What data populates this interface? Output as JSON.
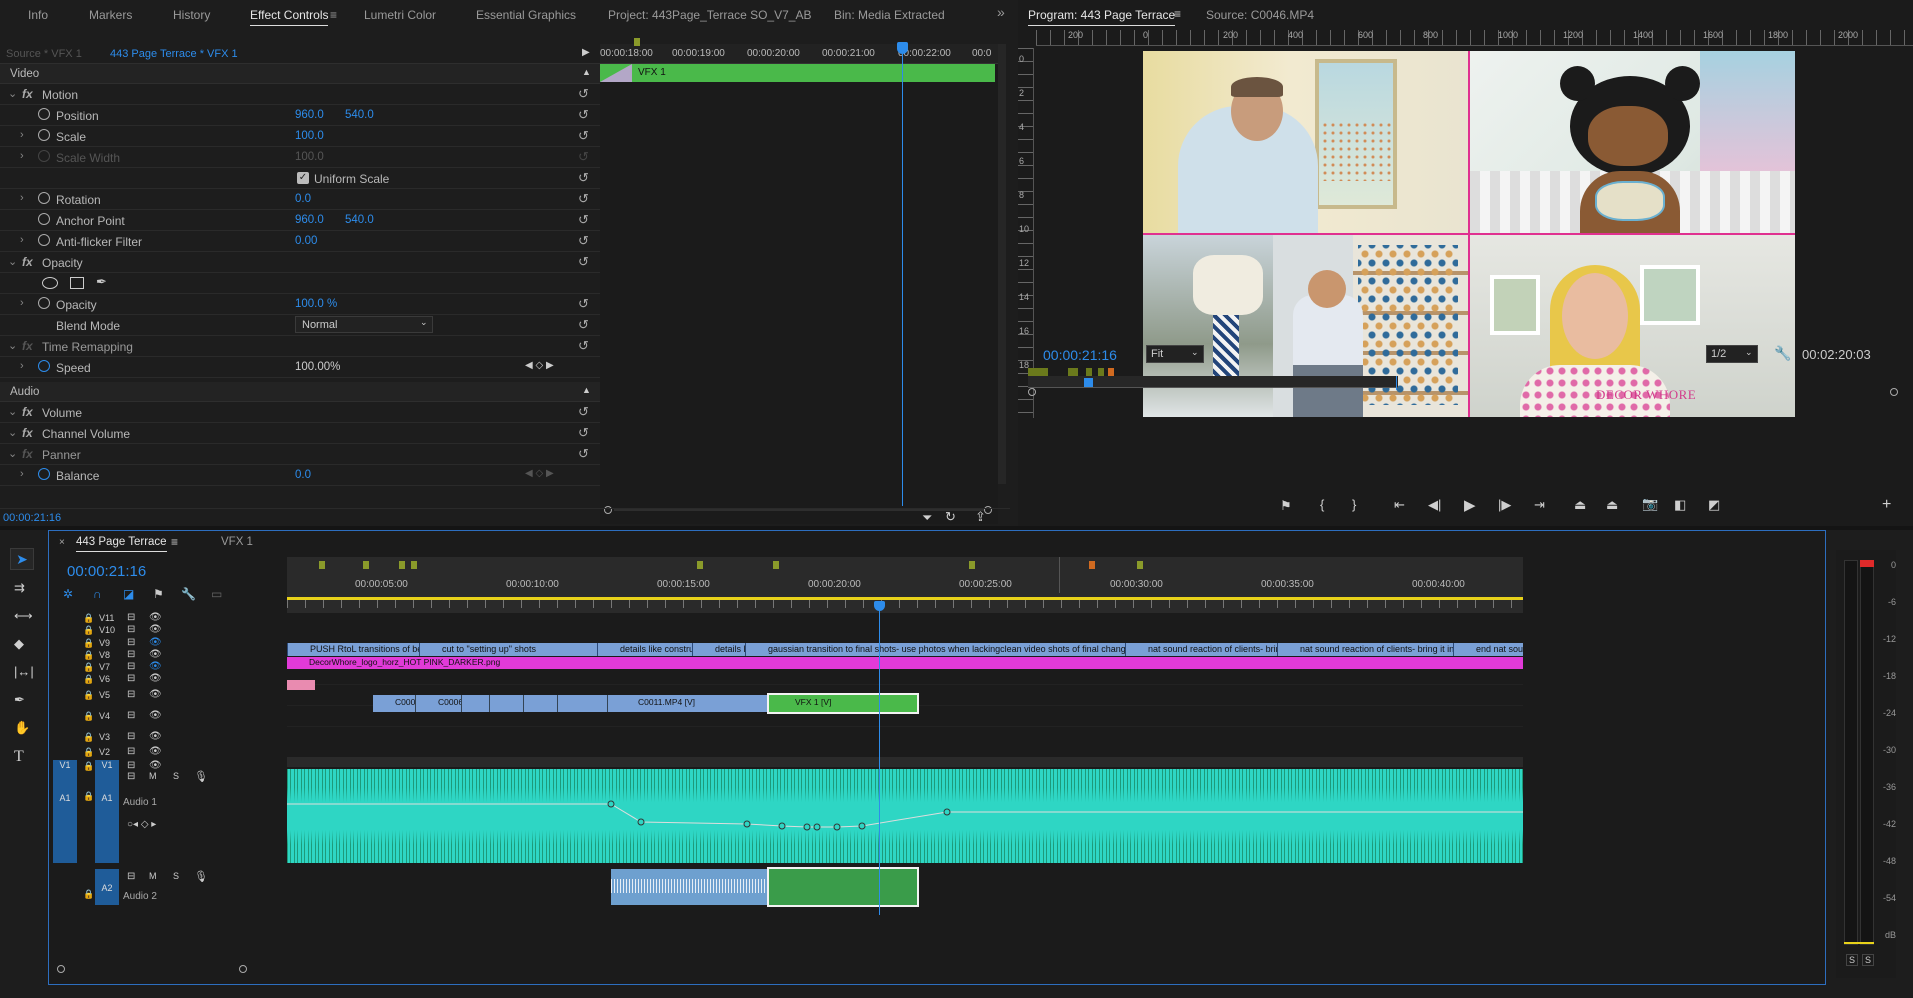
{
  "header": {
    "tabs": [
      "Info",
      "Markers",
      "History",
      "Effect Controls",
      "Lumetri Color",
      "Essential Graphics",
      "Project: 443Page_Terrace SO_V7_AB",
      "Bin: Media Extracted"
    ],
    "active_tab": "Effect Controls",
    "more": "»"
  },
  "program": {
    "tab": "Program: 443 Page Terrace",
    "source_tab": "Source: C0046.MP4",
    "timecode": "00:00:21:16",
    "fit": "Fit",
    "res": "1/2",
    "duration": "00:02:20:03",
    "ruler": [
      "200",
      "0",
      "200",
      "400",
      "600",
      "800",
      "1000",
      "1200",
      "1400",
      "1600",
      "1800",
      "2000"
    ],
    "vruler": [
      "0",
      "2",
      "4",
      "6",
      "8",
      "10",
      "12",
      "14",
      "16",
      "18"
    ],
    "watermark": "DECOR WHORE"
  },
  "effect_controls": {
    "source_label": "Source * VFX 1",
    "clip_label": "443 Page Terrace * VFX 1",
    "timeline_ticks": [
      "00:00:18:00",
      "00:00:19:00",
      "00:00:20:00",
      "00:00:21:00",
      "00:00:22:00",
      "00:0"
    ],
    "clip_name": "VFX 1",
    "video_section": "Video",
    "audio_section": "Audio",
    "timecode": "00:00:21:16",
    "rows": [
      {
        "type": "fx",
        "label": "Motion"
      },
      {
        "type": "prop",
        "label": "Position",
        "v1": "960.0",
        "v2": "540.0"
      },
      {
        "type": "prop",
        "label": "Scale",
        "v1": "100.0",
        "chev": true
      },
      {
        "type": "prop",
        "label": "Scale Width",
        "v1": "100.0",
        "dim": true,
        "chev": true
      },
      {
        "type": "check",
        "label": "Uniform Scale"
      },
      {
        "type": "prop",
        "label": "Rotation",
        "v1": "0.0",
        "chev": true
      },
      {
        "type": "prop",
        "label": "Anchor Point",
        "v1": "960.0",
        "v2": "540.0"
      },
      {
        "type": "prop",
        "label": "Anti-flicker Filter",
        "v1": "0.00",
        "chev": true
      },
      {
        "type": "fx",
        "label": "Opacity"
      },
      {
        "type": "shapes"
      },
      {
        "type": "prop",
        "label": "Opacity",
        "v1": "100.0 %",
        "chev": true
      },
      {
        "type": "blend",
        "label": "Blend Mode",
        "v1": "Normal"
      },
      {
        "type": "fxdim",
        "label": "Time Remapping"
      },
      {
        "type": "prop",
        "label": "Speed",
        "v1": "100.00%",
        "chev": true,
        "white": true
      }
    ],
    "audio_rows": [
      {
        "type": "fx",
        "label": "Volume"
      },
      {
        "type": "fx",
        "label": "Channel Volume"
      },
      {
        "type": "fxdim",
        "label": "Panner"
      },
      {
        "type": "prop",
        "label": "Balance",
        "v1": "0.0",
        "chev": true
      }
    ]
  },
  "timeline": {
    "tab": "443 Page Terrace",
    "tab2": "VFX 1",
    "timecode": "00:00:21:16",
    "ticks": [
      "00:00:05:00",
      "00:00:10:00",
      "00:00:15:00",
      "00:00:20:00",
      "00:00:25:00",
      "00:00:30:00",
      "00:00:35:00",
      "00:00:40:00"
    ],
    "tracks": [
      "V11",
      "V10",
      "V9",
      "V8",
      "V7",
      "V6",
      "V5",
      "V4",
      "V3",
      "V2",
      "V1"
    ],
    "v1_src": "V1",
    "a1_src": "A1",
    "a1": "A1",
    "a1_name": "Audio 1",
    "a2": "A2",
    "a2_name": "Audio 2",
    "v10_clips": [
      "PUSH RtoL transitions of bef",
      "cut to \"setting up\" shots",
      "details like construc",
      "details li",
      "gaussian transition to final shots- use photos when lackingclean video shots of final changes- moti",
      "nat sound reaction of clients- bring it in befo",
      "nat sound reaction of clients- bring it in before",
      "end nat sound"
    ],
    "v9_clip": "DecorWhore_logo_horz_HOT PINK_DARKER.png",
    "v6_clips": [
      "C000",
      "C0006",
      "C0011.MP4 [V]",
      "VFX 1 [V]"
    ]
  },
  "meter": {
    "labels": [
      "0",
      "-6",
      "-12",
      "-18",
      "-24",
      "-30",
      "-36",
      "-42",
      "-48",
      "-54",
      "dB"
    ],
    "solo": [
      "S",
      "S"
    ]
  }
}
